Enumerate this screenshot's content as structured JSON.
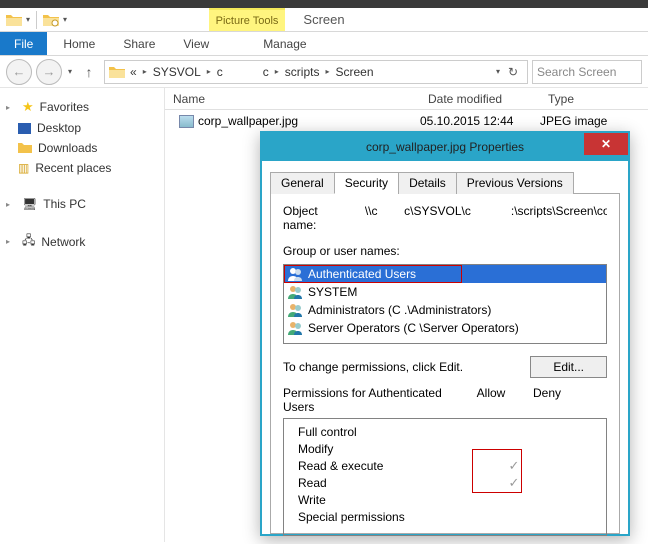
{
  "window": {
    "title": "Screen",
    "context_tab": "Picture Tools"
  },
  "ribbon": {
    "file": "File",
    "home": "Home",
    "share": "Share",
    "view": "View",
    "manage": "Manage"
  },
  "breadcrumb": {
    "segments": [
      "«",
      "SYSVOL",
      "c",
      "c",
      "scripts",
      "Screen"
    ],
    "search_placeholder": "Search Screen"
  },
  "sidebar": {
    "favorites": "Favorites",
    "desktop": "Desktop",
    "downloads": "Downloads",
    "recent": "Recent places",
    "this_pc": "This PC",
    "network": "Network"
  },
  "columns": {
    "name": "Name",
    "date": "Date modified",
    "type": "Type"
  },
  "file": {
    "name": "corp_wallpaper.jpg",
    "date": "05.10.2015 12:44",
    "type": "JPEG image"
  },
  "dialog": {
    "title": "corp_wallpaper.jpg Properties",
    "tabs": {
      "general": "General",
      "security": "Security",
      "details": "Details",
      "previous": "Previous Versions"
    },
    "object_label": "Object name:",
    "object_value": "\\\\c        c\\SYSVOL\\c            :\\scripts\\Screen\\corp_w",
    "group_label": "Group or user names:",
    "principals": [
      {
        "name": "Authenticated Users"
      },
      {
        "name": "SYSTEM"
      },
      {
        "name": "Administrators (C            .\\Administrators)"
      },
      {
        "name": "Server Operators (C            \\Server Operators)"
      }
    ],
    "change_text": "To change permissions, click Edit.",
    "edit_btn": "Edit...",
    "perm_for": "Permissions for Authenticated Users",
    "allow": "Allow",
    "deny": "Deny",
    "perms": [
      {
        "label": "Full control",
        "allow": false
      },
      {
        "label": "Modify",
        "allow": false
      },
      {
        "label": "Read & execute",
        "allow": true
      },
      {
        "label": "Read",
        "allow": true
      },
      {
        "label": "Write",
        "allow": false
      },
      {
        "label": "Special permissions",
        "allow": false
      }
    ]
  }
}
